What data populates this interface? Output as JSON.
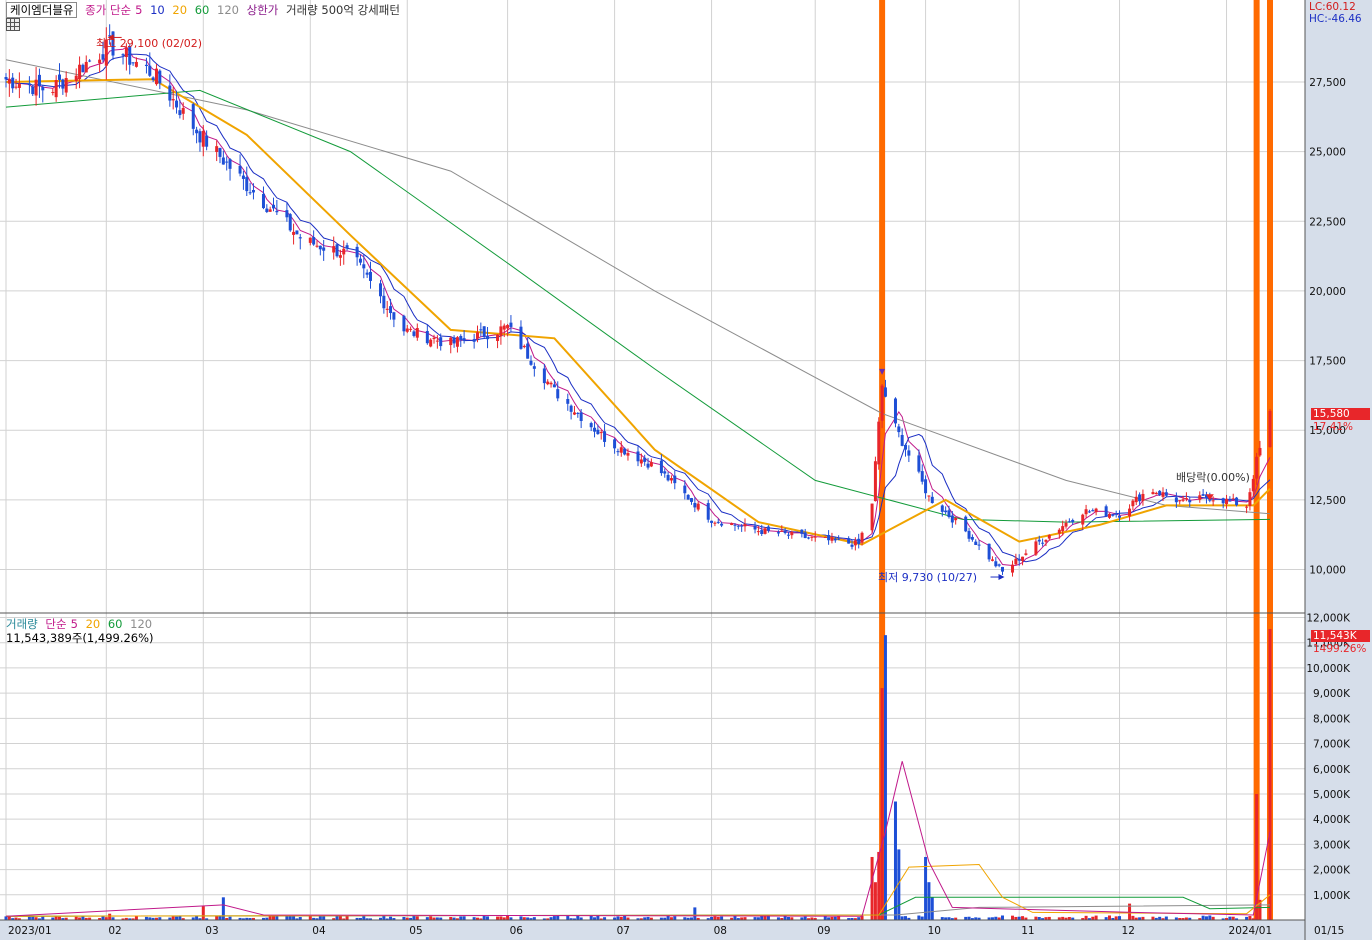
{
  "header": {
    "stock_name": "케이엠더블유",
    "ma_label": "종가 단순",
    "ma_periods": [
      "5",
      "10",
      "20",
      "60",
      "120"
    ],
    "ma_colors": [
      "#c0198a",
      "#1c2fc4",
      "#f0a400",
      "#139b3a",
      "#8c8c8c"
    ],
    "limit_up_label": "상한가",
    "volume_pattern_label": "거래량 500억 강세패턴",
    "lc": "LC:60.12",
    "hc": "HC:-46.46"
  },
  "volume_legend": {
    "title": "거래량",
    "ma_label": "단순",
    "periods": [
      "5",
      "20",
      "60",
      "120"
    ],
    "value": "11,543,389주(1,499.26%)"
  },
  "annotations": {
    "high": "최고 29,100 (02/02)",
    "low": "최저 9,730 (10/27)",
    "dividend": "배당락(0.00%)"
  },
  "price_tag": {
    "price": "15,580",
    "pct": "17.41%"
  },
  "volume_tag": {
    "value": "11,543K",
    "pct": "1499.26%"
  },
  "x_axis": {
    "labels": [
      "2023/01",
      "02",
      "03",
      "04",
      "05",
      "06",
      "07",
      "08",
      "09",
      "10",
      "11",
      "12",
      "2024/01",
      "01/15"
    ]
  },
  "chart_data": [
    {
      "type": "candlestick",
      "y_ticks": [
        "27,500",
        "25,000",
        "22,500",
        "20,000",
        "17,500",
        "15,000",
        "12,500",
        "10,000"
      ],
      "ylim": [
        9000,
        30000
      ],
      "colors": {
        "up": "#e8262a",
        "down": "#1e4fd6",
        "limit_up_bar": "#ff6a00"
      },
      "checkpoints": [
        {
          "t": "2023-01-02",
          "price": 27600
        },
        {
          "t": "2023-01-15",
          "price": 27200
        },
        {
          "t": "2023-02-02",
          "price": 28800
        },
        {
          "t": "2023-02-15",
          "price": 27800
        },
        {
          "t": "2023-03-01",
          "price": 25600
        },
        {
          "t": "2023-03-15",
          "price": 23800
        },
        {
          "t": "2023-04-01",
          "price": 21800
        },
        {
          "t": "2023-04-15",
          "price": 21300
        },
        {
          "t": "2023-05-01",
          "price": 18600
        },
        {
          "t": "2023-05-15",
          "price": 18100
        },
        {
          "t": "2023-06-01",
          "price": 18700
        },
        {
          "t": "2023-06-15",
          "price": 16400
        },
        {
          "t": "2023-07-01",
          "price": 14600
        },
        {
          "t": "2023-07-15",
          "price": 13700
        },
        {
          "t": "2023-08-01",
          "price": 11800
        },
        {
          "t": "2023-08-15",
          "price": 11400
        },
        {
          "t": "2023-09-01",
          "price": 11100
        },
        {
          "t": "2023-09-14",
          "price": 10900
        },
        {
          "t": "2023-09-18",
          "price": 12400
        },
        {
          "t": "2023-09-21",
          "price": 16600
        },
        {
          "t": "2023-09-25",
          "price": 15100
        },
        {
          "t": "2023-10-05",
          "price": 12600
        },
        {
          "t": "2023-10-15",
          "price": 11500
        },
        {
          "t": "2023-10-27",
          "price": 9900
        },
        {
          "t": "2023-11-06",
          "price": 10900
        },
        {
          "t": "2023-11-20",
          "price": 12100
        },
        {
          "t": "2023-12-01",
          "price": 12000
        },
        {
          "t": "2023-12-10",
          "price": 12900
        },
        {
          "t": "2023-12-20",
          "price": 12400
        },
        {
          "t": "2023-12-28",
          "price": 12600
        },
        {
          "t": "2024-01-08",
          "price": 12300
        },
        {
          "t": "2024-01-11",
          "price": 13900
        },
        {
          "t": "2024-01-15",
          "price": 15580
        }
      ],
      "limit_up_days": [
        "2023-09-21",
        "2024-01-11",
        "2024-01-15"
      ],
      "high": {
        "price": 29100,
        "date": "02/02"
      },
      "low": {
        "price": 9730,
        "date": "10/27"
      },
      "ma_curves": {
        "ma5_10": "close",
        "ma20": [
          {
            "t": "2023-01-02",
            "v": 27500
          },
          {
            "t": "2023-02-15",
            "v": 27600
          },
          {
            "t": "2023-03-15",
            "v": 25600
          },
          {
            "t": "2023-04-15",
            "v": 22000
          },
          {
            "t": "2023-05-15",
            "v": 18600
          },
          {
            "t": "2023-06-15",
            "v": 18300
          },
          {
            "t": "2023-07-15",
            "v": 14300
          },
          {
            "t": "2023-08-15",
            "v": 11700
          },
          {
            "t": "2023-09-15",
            "v": 10900
          },
          {
            "t": "2023-10-10",
            "v": 12500
          },
          {
            "t": "2023-11-01",
            "v": 11000
          },
          {
            "t": "2023-11-25",
            "v": 11600
          },
          {
            "t": "2023-12-15",
            "v": 12300
          },
          {
            "t": "2024-01-10",
            "v": 12300
          },
          {
            "t": "2024-01-15",
            "v": 12900
          }
        ],
        "ma60": [
          {
            "t": "2023-01-02",
            "v": 26600
          },
          {
            "t": "2023-03-01",
            "v": 27200
          },
          {
            "t": "2023-04-15",
            "v": 25000
          },
          {
            "t": "2023-06-01",
            "v": 21000
          },
          {
            "t": "2023-07-15",
            "v": 17200
          },
          {
            "t": "2023-09-01",
            "v": 13200
          },
          {
            "t": "2023-10-15",
            "v": 11800
          },
          {
            "t": "2023-11-15",
            "v": 11700
          },
          {
            "t": "2024-01-15",
            "v": 11800
          }
        ],
        "ma120": [
          {
            "t": "2023-01-02",
            "v": 28300
          },
          {
            "t": "2023-03-15",
            "v": 26500
          },
          {
            "t": "2023-05-15",
            "v": 24300
          },
          {
            "t": "2023-07-15",
            "v": 20000
          },
          {
            "t": "2023-09-21",
            "v": 15600
          },
          {
            "t": "2023-11-15",
            "v": 13200
          },
          {
            "t": "2023-12-15",
            "v": 12300
          },
          {
            "t": "2024-01-15",
            "v": 12000
          }
        ]
      }
    },
    {
      "type": "bar",
      "series_name": "거래량",
      "y_ticks": [
        "12,000K",
        "11,000K",
        "10,000K",
        "9,000K",
        "8,000K",
        "7,000K",
        "6,000K",
        "5,000K",
        "4,000K",
        "3,000K",
        "2,000K",
        "1,000K"
      ],
      "ylim": [
        0,
        12000
      ],
      "unit": "K",
      "baseline": 120,
      "spikes": [
        {
          "t": "2023-02-02",
          "v": 250
        },
        {
          "t": "2023-03-02",
          "v": 550
        },
        {
          "t": "2023-03-08",
          "v": 900
        },
        {
          "t": "2023-07-27",
          "v": 500
        },
        {
          "t": "2023-09-18",
          "v": 2500
        },
        {
          "t": "2023-09-19",
          "v": 1500
        },
        {
          "t": "2023-09-20",
          "v": 2700
        },
        {
          "t": "2023-09-21",
          "v": 9200
        },
        {
          "t": "2023-09-22",
          "v": 11300
        },
        {
          "t": "2023-09-25",
          "v": 4700
        },
        {
          "t": "2023-09-26",
          "v": 2800
        },
        {
          "t": "2023-10-04",
          "v": 2500
        },
        {
          "t": "2023-10-05",
          "v": 1500
        },
        {
          "t": "2023-10-06",
          "v": 900
        },
        {
          "t": "2023-12-04",
          "v": 650
        },
        {
          "t": "2024-01-11",
          "v": 5000
        },
        {
          "t": "2024-01-12",
          "v": 800
        },
        {
          "t": "2024-01-15",
          "v": 11543
        }
      ],
      "ma_curves": {
        "ma5": [
          {
            "t": "2023-01-02",
            "v": 150
          },
          {
            "t": "2023-03-08",
            "v": 600
          },
          {
            "t": "2023-03-20",
            "v": 200
          },
          {
            "t": "2023-09-15",
            "v": 150
          },
          {
            "t": "2023-09-22",
            "v": 3500
          },
          {
            "t": "2023-09-27",
            "v": 6300
          },
          {
            "t": "2023-10-05",
            "v": 2300
          },
          {
            "t": "2023-10-12",
            "v": 500
          },
          {
            "t": "2023-12-05",
            "v": 300
          },
          {
            "t": "2024-01-10",
            "v": 200
          },
          {
            "t": "2024-01-15",
            "v": 3500
          }
        ],
        "ma20": [
          {
            "t": "2023-01-02",
            "v": 150
          },
          {
            "t": "2023-09-20",
            "v": 200
          },
          {
            "t": "2023-09-29",
            "v": 2100
          },
          {
            "t": "2023-10-20",
            "v": 2200
          },
          {
            "t": "2023-10-27",
            "v": 900
          },
          {
            "t": "2023-11-05",
            "v": 300
          },
          {
            "t": "2024-01-08",
            "v": 250
          },
          {
            "t": "2024-01-15",
            "v": 1000
          }
        ],
        "ma60": [
          {
            "t": "2023-01-02",
            "v": 150
          },
          {
            "t": "2023-09-20",
            "v": 200
          },
          {
            "t": "2023-10-01",
            "v": 900
          },
          {
            "t": "2023-12-20",
            "v": 900
          },
          {
            "t": "2023-12-28",
            "v": 450
          },
          {
            "t": "2024-01-15",
            "v": 500
          }
        ],
        "ma120": [
          {
            "t": "2023-01-02",
            "v": 150
          },
          {
            "t": "2023-09-25",
            "v": 200
          },
          {
            "t": "2023-10-20",
            "v": 500
          },
          {
            "t": "2024-01-15",
            "v": 600
          }
        ]
      }
    }
  ]
}
